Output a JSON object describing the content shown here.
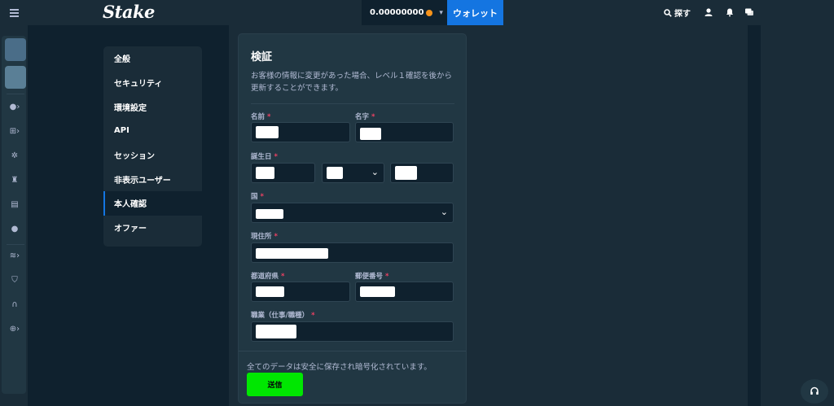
{
  "header": {
    "logo": "Stake",
    "balance": "0.00000000",
    "wallet_label": "ウォレット",
    "search_label": "探す"
  },
  "settings_menu": {
    "items": [
      {
        "label": "全般",
        "active": false
      },
      {
        "label": "セキュリティ",
        "active": false
      },
      {
        "label": "環境設定",
        "active": false
      },
      {
        "label": "API",
        "active": false
      },
      {
        "label": "セッション",
        "active": false
      },
      {
        "label": "非表示ユーザー",
        "active": false
      },
      {
        "label": "本人確認",
        "active": true
      },
      {
        "label": "オファー",
        "active": false
      }
    ]
  },
  "form": {
    "title": "検証",
    "description": "お客様の情報に変更があった場合、レベル１確認を後から更新することができます。",
    "fields": {
      "first_name": "名前",
      "last_name": "名字",
      "birthday": "誕生日",
      "country": "国",
      "address": "現住所",
      "prefecture": "都道府県",
      "postal_code": "郵便番号",
      "occupation": "職業（仕事/職種）"
    },
    "required_mark": "*",
    "footer_note": "全てのデータは安全に保存され暗号化されています。",
    "submit_label": "送信"
  },
  "colors": {
    "accent": "#1475e1",
    "submit": "#00e701",
    "required": "#ed4163"
  }
}
